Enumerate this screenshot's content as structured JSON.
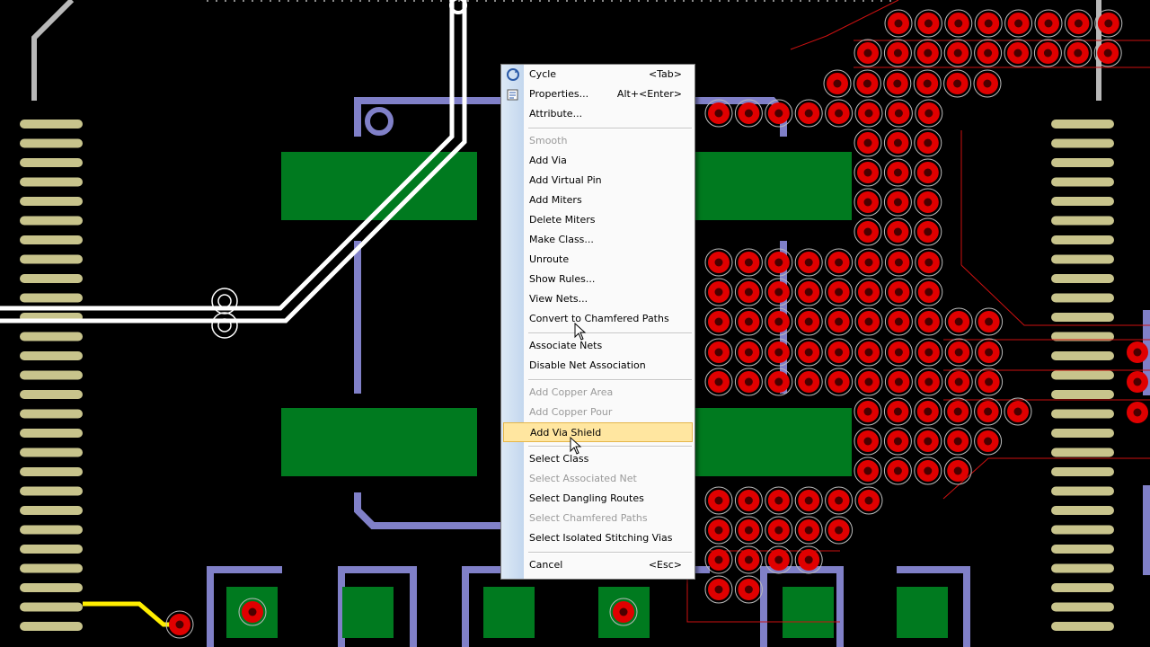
{
  "context_menu": {
    "items": [
      {
        "label": "Cycle",
        "shortcut": "<Tab>",
        "enabled": true,
        "icon": "cycle-icon"
      },
      {
        "label": "Properties...",
        "shortcut": "Alt+<Enter>",
        "enabled": true,
        "icon": "properties-icon"
      },
      {
        "label": "Attribute...",
        "shortcut": "",
        "enabled": true
      },
      {
        "label": "Smooth",
        "shortcut": "",
        "enabled": false
      },
      {
        "label": "Add Via",
        "shortcut": "",
        "enabled": true
      },
      {
        "label": "Add Virtual Pin",
        "shortcut": "",
        "enabled": true
      },
      {
        "label": "Add Miters",
        "shortcut": "",
        "enabled": true
      },
      {
        "label": "Delete Miters",
        "shortcut": "",
        "enabled": true
      },
      {
        "label": "Make Class...",
        "shortcut": "",
        "enabled": true
      },
      {
        "label": "Unroute",
        "shortcut": "",
        "enabled": true
      },
      {
        "label": "Show Rules...",
        "shortcut": "",
        "enabled": true
      },
      {
        "label": "View Nets...",
        "shortcut": "",
        "enabled": true
      },
      {
        "label": "Convert to Chamfered Paths",
        "shortcut": "",
        "enabled": true
      },
      {
        "label": "Associate Nets",
        "shortcut": "",
        "enabled": true
      },
      {
        "label": "Disable Net Association",
        "shortcut": "",
        "enabled": true
      },
      {
        "label": "Add Copper Area",
        "shortcut": "",
        "enabled": false
      },
      {
        "label": "Add Copper Pour",
        "shortcut": "",
        "enabled": false
      },
      {
        "label": "Add Via Shield",
        "shortcut": "",
        "enabled": true,
        "highlighted": true
      },
      {
        "label": "Select Class",
        "shortcut": "",
        "enabled": true
      },
      {
        "label": "Select Associated Net",
        "shortcut": "",
        "enabled": false
      },
      {
        "label": "Select Dangling Routes",
        "shortcut": "",
        "enabled": true
      },
      {
        "label": "Select Chamfered Paths",
        "shortcut": "",
        "enabled": false
      },
      {
        "label": "Select Isolated Stitching Vias",
        "shortcut": "",
        "enabled": true
      },
      {
        "label": "Cancel",
        "shortcut": "<Esc>",
        "enabled": true
      }
    ]
  },
  "colors": {
    "background": "#000000",
    "trace": "#ffffff",
    "selected_trace": "#ffee00",
    "silkscreen_outline": "#8080c8",
    "copper_pad": "#007a1f",
    "via": "#e00000",
    "smd_pin": "#c8c48c",
    "ratsnest": "#cc1111",
    "menu_highlight": "#ffe6a0"
  }
}
